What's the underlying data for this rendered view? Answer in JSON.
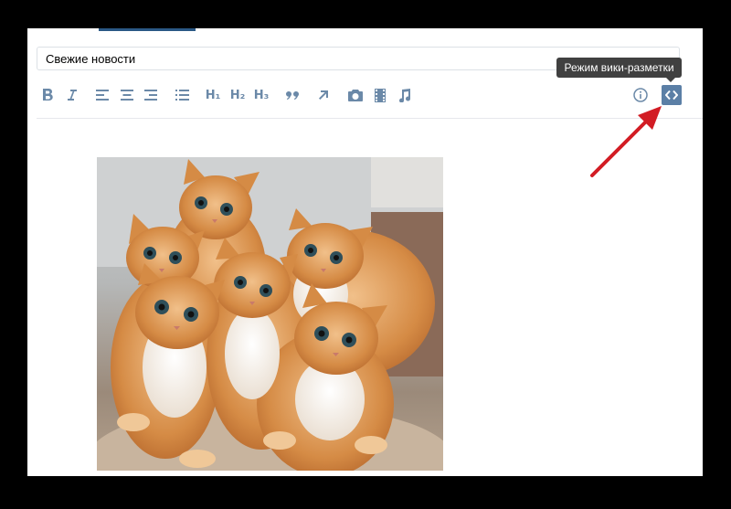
{
  "editor": {
    "title_value": "Свежие новости",
    "tooltip": "Режим вики-разметки"
  },
  "toolbar": {
    "h1": "H₁",
    "h2": "H₂",
    "h3": "H₃"
  },
  "colors": {
    "accent": "#5b7fa6",
    "icon": "#6b89a8",
    "annotation_arrow": "#d21c24"
  }
}
